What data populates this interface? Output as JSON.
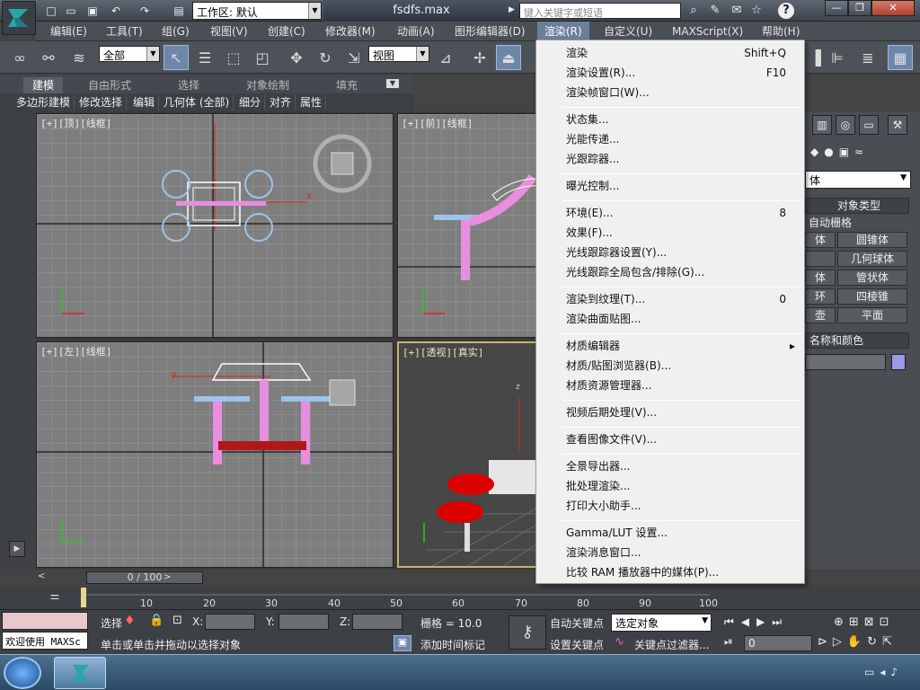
{
  "titlebar": {
    "workspace": "工作区: 默认",
    "document": "fsdfs.max",
    "search_placeholder": "键入关键字或短语",
    "help_icon": "?"
  },
  "menubar": {
    "items": [
      "编辑(E)",
      "工具(T)",
      "组(G)",
      "视图(V)",
      "创建(C)",
      "修改器(M)",
      "动画(A)",
      "图形编辑器(D)",
      "渲染(R)",
      "自定义(U)",
      "MAXScript(X)",
      "帮助(H)"
    ],
    "active": "渲染(R)"
  },
  "toolbar": {
    "selection_filter": "全部",
    "reference_coord": "视图"
  },
  "ribbon": {
    "tabs": [
      "建模",
      "自由形式",
      "选择",
      "对象绘制",
      "填充"
    ],
    "sub_items": [
      "多边形建模",
      "修改选择",
      "编辑",
      "几何体 (全部)",
      "细分",
      "对齐",
      "属性"
    ]
  },
  "viewports": {
    "top": "[+][顶][线框]",
    "front": "[+][前][线框]",
    "left": "[+][左][线框]",
    "perspective": "[+][透视][真实]",
    "axis_x": "x",
    "axis_y": "y",
    "axis_z": "z"
  },
  "command_panel": {
    "category": "体",
    "rollout_object_type": "对象类型",
    "autogrid": "自动栅格",
    "buttons": [
      "体",
      "圆锥体",
      "",
      "几何球体",
      "体",
      "管状体",
      "环",
      "四棱锥",
      "壶",
      "平面"
    ],
    "rollout_name_color": "名称和颜色"
  },
  "timeline": {
    "frame": "0 / 100",
    "ticks": [
      "10",
      "20",
      "30",
      "40",
      "50",
      "60",
      "70",
      "80",
      "90",
      "100"
    ]
  },
  "status": {
    "welcome": "欢迎使用 MAXSc",
    "select_label": "选择",
    "x_label": "X:",
    "y_label": "Y:",
    "z_label": "Z:",
    "grid": "栅格 = 10.0",
    "prompt": "单击或单击并拖动以选择对象",
    "add_time_tag": "添加时间标记",
    "auto_key": "自动关键点",
    "set_key": "设置关键点",
    "selected_object": "选定对象",
    "key_filters": "关键点过滤器...",
    "current_frame": "0"
  },
  "render_menu": {
    "items": [
      {
        "label": "渲染",
        "shortcut": "Shift+Q"
      },
      {
        "label": "渲染设置(R)...",
        "shortcut": "F10"
      },
      {
        "label": "渲染帧窗口(W)...",
        "shortcut": ""
      },
      {
        "sep": true
      },
      {
        "label": "状态集...",
        "shortcut": ""
      },
      {
        "label": "光能传递...",
        "shortcut": ""
      },
      {
        "label": "光跟踪器...",
        "shortcut": ""
      },
      {
        "sep": true
      },
      {
        "label": "曝光控制...",
        "shortcut": ""
      },
      {
        "sep": true
      },
      {
        "label": "环境(E)...",
        "shortcut": "8"
      },
      {
        "label": "效果(F)...",
        "shortcut": ""
      },
      {
        "label": "光线跟踪器设置(Y)...",
        "shortcut": ""
      },
      {
        "label": "光线跟踪全局包含/排除(G)...",
        "shortcut": ""
      },
      {
        "sep": true
      },
      {
        "label": "渲染到纹理(T)...",
        "shortcut": "0"
      },
      {
        "label": "渲染曲面贴图...",
        "shortcut": ""
      },
      {
        "sep": true
      },
      {
        "label": "材质编辑器",
        "shortcut": "▸"
      },
      {
        "label": "材质/贴图浏览器(B)...",
        "shortcut": ""
      },
      {
        "label": "材质资源管理器...",
        "shortcut": ""
      },
      {
        "sep": true
      },
      {
        "label": "视频后期处理(V)...",
        "shortcut": ""
      },
      {
        "sep": true
      },
      {
        "label": "查看图像文件(V)...",
        "shortcut": ""
      },
      {
        "sep": true
      },
      {
        "label": "全景导出器...",
        "shortcut": ""
      },
      {
        "label": "批处理渲染...",
        "shortcut": ""
      },
      {
        "label": "打印大小助手...",
        "shortcut": ""
      },
      {
        "sep": true
      },
      {
        "label": "Gamma/LUT 设置...",
        "shortcut": ""
      },
      {
        "label": "渲染消息窗口...",
        "shortcut": ""
      },
      {
        "label": "比较 RAM 播放器中的媒体(P)...",
        "shortcut": ""
      }
    ]
  }
}
